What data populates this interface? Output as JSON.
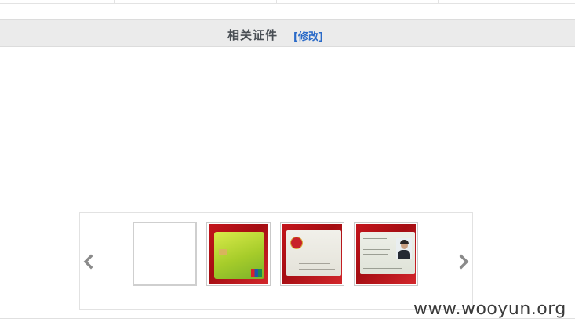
{
  "section": {
    "title": "相关证件",
    "edit_link": "[修改]"
  },
  "carousel": {
    "prev_icon": "chevron-left-icon",
    "next_icon": "chevron-right-icon",
    "thumbnails": [
      {
        "name": "thumbnail-blank"
      },
      {
        "name": "thumbnail-bank-card"
      },
      {
        "name": "thumbnail-id-card-back"
      },
      {
        "name": "thumbnail-id-card-front"
      }
    ]
  },
  "watermark": {
    "text": "www.wooyun.org"
  },
  "colors": {
    "header_bg": "#ebebeb",
    "title_text": "#4a4f55",
    "link_text": "#2a6ac8"
  }
}
